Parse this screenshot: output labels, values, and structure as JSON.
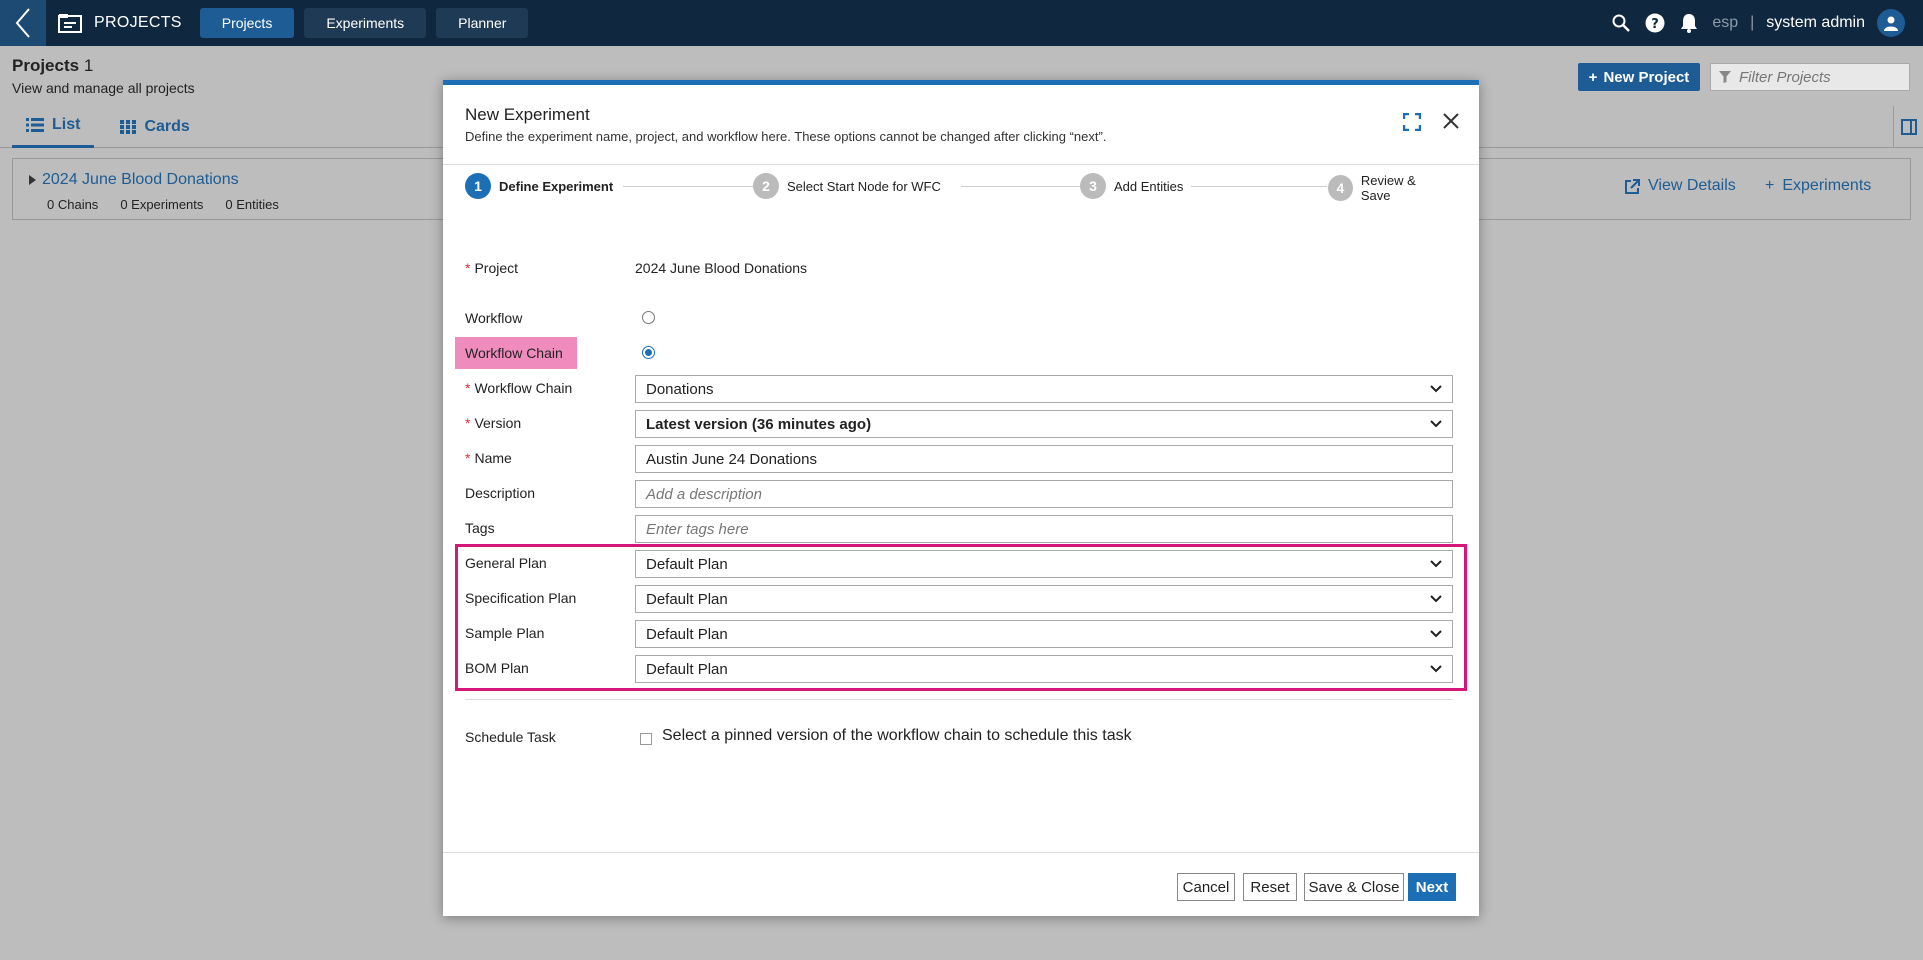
{
  "topbar": {
    "app_title": "PROJECTS",
    "tabs": [
      {
        "label": "Projects",
        "active": true
      },
      {
        "label": "Experiments",
        "active": false
      },
      {
        "label": "Planner",
        "active": false
      }
    ],
    "lab": "esp",
    "separator": "|",
    "user": "system admin"
  },
  "page": {
    "title": "Projects",
    "count": "1",
    "subtitle": "View and manage all projects",
    "new_project_label": "New Project",
    "filter_placeholder": "Filter Projects",
    "view_tabs": [
      "List",
      "Cards"
    ]
  },
  "project_card": {
    "name": "2024 June Blood Donations",
    "chains": "0 Chains",
    "experiments": "0 Experiments",
    "entities": "0 Entities",
    "view_details_label": "View Details",
    "experiments_label": "Experiments"
  },
  "modal": {
    "title": "New Experiment",
    "subtitle": "Define the experiment name, project, and workflow here. These options cannot be changed after clicking “next”.",
    "steps": [
      {
        "number": "1",
        "label": "Define Experiment",
        "active": true
      },
      {
        "number": "2",
        "label": "Select Start Node for WFC",
        "active": false
      },
      {
        "number": "3",
        "label": "Add Entities",
        "active": false
      },
      {
        "number": "4",
        "label": "Review & Save",
        "active": false
      }
    ],
    "form": {
      "required_mark": "*",
      "project_label": "Project",
      "project_value": "2024 June Blood Donations",
      "workflow_label": "Workflow",
      "workflow_chain_radio_label": "Workflow Chain",
      "selected_type": "Workflow Chain",
      "workflow_chain_label": "Workflow Chain",
      "workflow_chain_value": "Donations",
      "version_label": "Version",
      "version_value": "Latest version (36 minutes ago)",
      "name_label": "Name",
      "name_value": "Austin June 24 Donations",
      "description_label": "Description",
      "description_placeholder": "Add a description",
      "tags_label": "Tags",
      "tags_placeholder": "Enter tags here",
      "general_plan_label": "General Plan",
      "general_plan_value": "Default Plan",
      "specification_plan_label": "Specification Plan",
      "specification_plan_value": "Default Plan",
      "sample_plan_label": "Sample Plan",
      "sample_plan_value": "Default Plan",
      "bom_plan_label": "BOM Plan",
      "bom_plan_value": "Default Plan",
      "schedule_task_label": "Schedule Task",
      "schedule_task_text": "Select a pinned version of the workflow chain to schedule this task",
      "schedule_task_checked": false
    },
    "buttons": {
      "cancel": "Cancel",
      "reset": "Reset",
      "save_close": "Save & Close",
      "next": "Next"
    }
  },
  "colors": {
    "topbar": "#10283f",
    "primary": "#1d6fb5",
    "link": "#1d5c94",
    "highlight_fill": "#f08cbd",
    "highlight_border": "#d6177a",
    "required": "#d33333"
  }
}
